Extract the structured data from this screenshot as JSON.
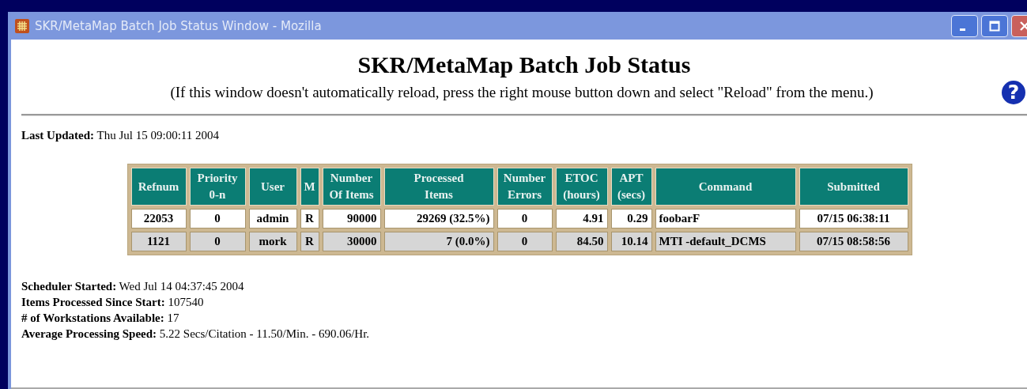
{
  "window": {
    "title": "SKR/MetaMap Batch Job Status Window - Mozilla"
  },
  "page": {
    "heading": "SKR/MetaMap Batch Job Status",
    "note": "(If this window doesn't automatically reload, press the right mouse button down and select \"Reload\" from the menu.)",
    "help": "?"
  },
  "last_updated": {
    "label": "Last Updated:",
    "value": "Thu Jul 15 09:00:11 2004"
  },
  "table": {
    "columns": [
      "Refnum",
      "Priority\n0-n",
      "User",
      "M",
      "Number\nOf Items",
      "Processed\nItems",
      "Number\nErrors",
      "ETOC\n(hours)",
      "APT\n(secs)",
      "Command",
      "Submitted"
    ],
    "rows": [
      [
        "22053",
        "0",
        "admin",
        "R",
        "90000",
        "29269 (32.5%)",
        "0",
        "4.91",
        "0.29",
        "foobarF",
        "07/15 06:38:11"
      ],
      [
        "1121",
        "0",
        "mork",
        "R",
        "30000",
        "7 (0.0%)",
        "0",
        "84.50",
        "10.14",
        "MTI -default_DCMS",
        "07/15 08:58:56"
      ]
    ]
  },
  "stats": [
    {
      "label": "Scheduler Started:",
      "value": "Wed Jul 14 04:37:45 2004"
    },
    {
      "label": "Items Processed Since Start:",
      "value": "107540"
    },
    {
      "label": "# of Workstations Available:",
      "value": "17"
    },
    {
      "label": "Average Processing Speed:",
      "value": "5.22 Secs/Citation - 11.50/Min. - 690.06/Hr."
    }
  ]
}
